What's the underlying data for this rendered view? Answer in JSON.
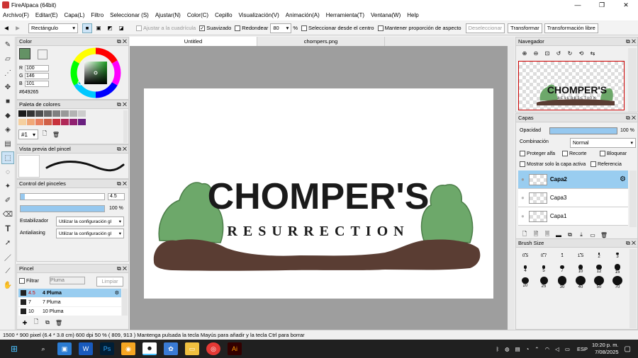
{
  "window": {
    "title": "FireAlpaca (64bit)",
    "min": "—",
    "max": "❐",
    "close": "✕"
  },
  "menu": [
    "Archivo(F)",
    "Editar(E)",
    "Capa(L)",
    "Filtro",
    "Seleccionar (S)",
    "Ajustar(N)",
    "Color(C)",
    "Cepillo",
    "Visualización(V)",
    "Animación(A)",
    "Herramienta(T)",
    "Ventana(W)",
    "Help"
  ],
  "toolbar": {
    "shape_select": "Rectángulo",
    "snap_grid": "Ajustar a la cuadrícula",
    "antialias": "Suavizado",
    "rounded": "Redondear",
    "rounded_value": "80",
    "percent": "%",
    "select_from_center": "Seleccionar desde el centro",
    "keep_aspect": "Mantener proporción de aspecto",
    "deselect": "Deseleccionar",
    "transform": "Transformar",
    "free_transform": "Transformación libre"
  },
  "color_panel": {
    "title": "Color",
    "r_label": "R",
    "r": "100",
    "g_label": "G",
    "g": "146",
    "b_label": "B",
    "b": "101",
    "hex": "#649265",
    "current_color": "#649265"
  },
  "palette_panel": {
    "title": "Paleta de colores",
    "selector": "#1",
    "row1": [
      "#1a1a1a",
      "#333333",
      "#4d4d4d",
      "#666666",
      "#808080",
      "#999999",
      "#b3b3b3",
      "#cccccc"
    ],
    "row2": [
      "#f5d0a0",
      "#f0a878",
      "#e88060",
      "#d06048",
      "#c8323c",
      "#b02858",
      "#902070",
      "#6a2080"
    ]
  },
  "brush_preview": {
    "title": "Vista previa del pincel"
  },
  "brush_control": {
    "title": "Control del pinceles",
    "size_value": "4.5",
    "opacity_value": "100 %",
    "opacity_fraction": 1.0,
    "size_fraction": 0.05,
    "stabilizer_label": "Estabilizador",
    "stabilizer_value": "Utilizar la configuración gl",
    "antialias_label": "Antialiasing",
    "antialias_value": "Utilizar la configuración gl"
  },
  "brush_panel": {
    "title": "Pincel",
    "filter": "Filtrar",
    "search_placeholder": "Pluma",
    "clear": "Limpiar",
    "items": [
      {
        "size": "4.5",
        "name": "4 Pluma"
      },
      {
        "size": "7",
        "name": "7 Pluma"
      },
      {
        "size": "10",
        "name": "10 Pluma"
      }
    ]
  },
  "tabs": [
    "Untitled",
    "chompers.png"
  ],
  "artwork": {
    "line1": "CHOMPER'S",
    "line2": "RESURRECTION"
  },
  "navigator": {
    "title": "Navegador",
    "line1": "CHOMPER'S",
    "line2": "RESURRECTION"
  },
  "layers_panel": {
    "title": "Capas",
    "opacity_label": "Opacidad",
    "opacity_value": "100 %",
    "opacity_fraction": 1.0,
    "blend_label": "Combinación",
    "blend_value": "Normal",
    "protect_alpha": "Proteger alfa",
    "clip": "Recorte",
    "lock": "Bloquear",
    "show_active_only": "Mostrar solo la capa activa",
    "reference": "Referencia",
    "layers": [
      "Capa2",
      "Capa3",
      "Capa1"
    ]
  },
  "brush_size": {
    "title": "Brush Size",
    "labels": [
      "0.5",
      "0.7",
      "1",
      "1.5",
      "2",
      "3",
      "4",
      "5",
      "7",
      "10",
      "12",
      "15",
      "20",
      "25",
      "30",
      "40",
      "50",
      "70"
    ]
  },
  "status": "1500 * 900 pixel   (6.4 * 3.8 cm)  600 dpi   50 %   ( 809, 913 )   Mantenga pulsada la tecla Mayús para añadir y la tecla Ctrl para borrar",
  "taskbar": {
    "time": "10:20 p. m.",
    "date": "7/08/2025",
    "lang": "ESP"
  }
}
